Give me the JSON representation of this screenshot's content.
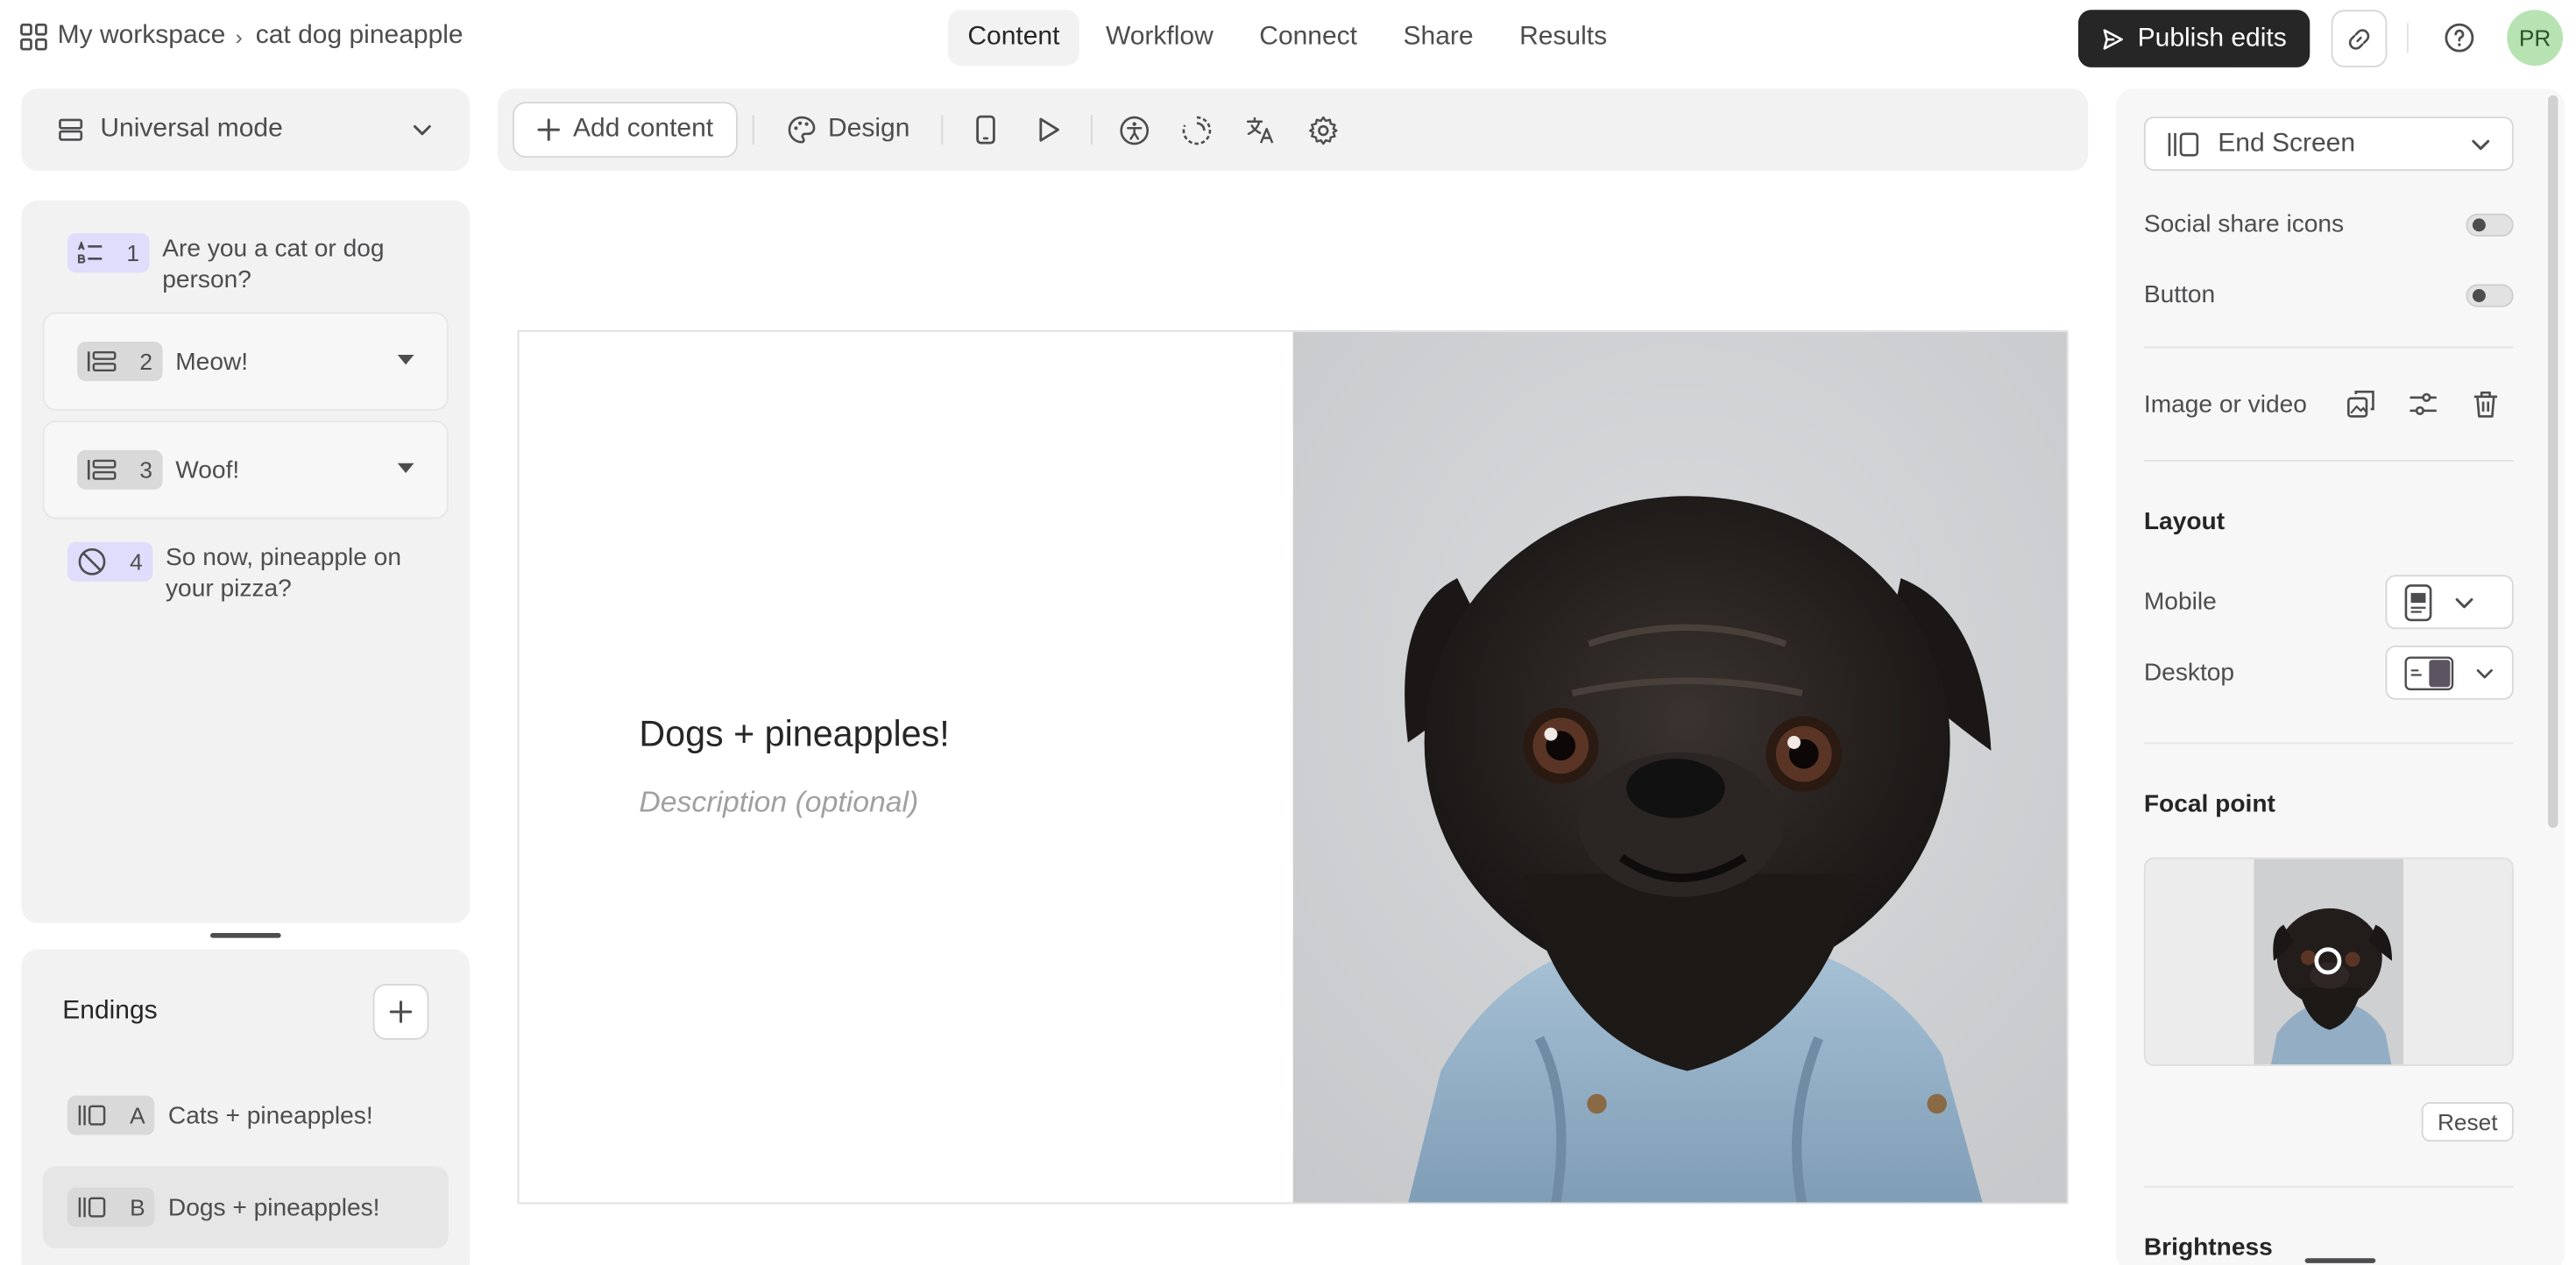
{
  "breadcrumb": {
    "workspace": "My workspace",
    "form": "cat dog pineapple"
  },
  "tabs": [
    "Content",
    "Workflow",
    "Connect",
    "Share",
    "Results"
  ],
  "active_tab": "Content",
  "publish_label": "Publish edits",
  "avatar_initials": "PR",
  "mode": "Universal mode",
  "questions": [
    {
      "number": "1",
      "text": "Are you a cat or dog person?",
      "icon": "multiple-choice-icon"
    },
    {
      "number": "2",
      "text": "Meow!",
      "icon": "statement-icon"
    },
    {
      "number": "3",
      "text": "Woof!",
      "icon": "statement-icon"
    },
    {
      "number": "4",
      "text": "So now, pineapple on your pizza?",
      "icon": "yes-no-icon"
    }
  ],
  "endings": {
    "title": "Endings",
    "items": [
      {
        "letter": "A",
        "text": "Cats + pineapples!"
      },
      {
        "letter": "B",
        "text": "Dogs + pineapples!"
      }
    ]
  },
  "toolbar": {
    "add_content": "Add content",
    "design": "Design"
  },
  "screen": {
    "title": "Dogs + pineapples!",
    "description_placeholder": "Description (optional)"
  },
  "right_panel": {
    "screen_type": "End Screen",
    "social_share_label": "Social share icons",
    "button_label": "Button",
    "image_label": "Image or video",
    "layout_title": "Layout",
    "mobile_label": "Mobile",
    "desktop_label": "Desktop",
    "focal_title": "Focal point",
    "reset_label": "Reset",
    "brightness_label": "Brightness"
  },
  "colors": {
    "accent_dark": "#262627",
    "chip_purple": "#e0dcfb",
    "avatar_green": "#b6e3b1"
  }
}
